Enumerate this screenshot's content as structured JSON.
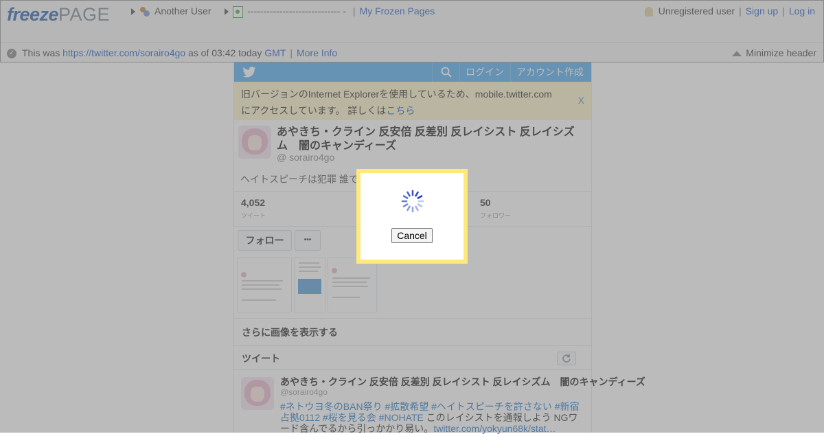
{
  "header": {
    "logo_freeze": "freeze",
    "logo_page": "PAGE",
    "breadcrumb_user": "Another User",
    "breadcrumb_page": "----------------------------- -",
    "breadcrumb_sep": "|",
    "my_frozen_pages": "My Frozen Pages",
    "unregistered_user": "Unregistered user",
    "sign_up": "Sign up",
    "log_in": "Log in",
    "info_prefix": "This was",
    "info_url": "https://twitter.com/sorairo4go",
    "info_time": "as of 03:42 today",
    "info_tz": "GMT",
    "more_info": "More Info",
    "minimize": "Minimize header",
    "accent_color": "#2a62c9"
  },
  "twitter": {
    "login": "ログイン",
    "signup": "アカウント作成",
    "notice_line1": "旧バージョンのInternet Explorerを使用しているため、mobile.twitter.com",
    "notice_line2": "にアクセスしています。 詳しくは",
    "notice_link": "こちら",
    "notice_close": "X",
    "name": "あやきち・クライン 反安倍 反差別 反レイシスト 反レイシズム　闇のキャンディーズ",
    "handle": "@ sorairo4go",
    "bio": "ヘイトスピーチは犯罪 誰で",
    "stats": [
      {
        "num": "4,052",
        "label": "ツイート"
      },
      {
        "num": "50",
        "label": "フォロワー"
      }
    ],
    "follow": "フォロー",
    "more": "•••",
    "more_media": "さらに画像を表示する",
    "tweets_header": "ツイート",
    "tweet": {
      "name": "あやきち・クライン 反安倍 反差別 反レイシスト 反レイシズム　闇のキャンディーズ",
      "handle": "@sorairo4go",
      "hashtags": "#ネトウヨ冬のBAN祭り #拡散希望 #ヘイトスピーチを許さない #新宿占拠0112 #桜を見る会 #NOHATE",
      "text": " このレイシストを通報しよう NGワード含んでるから引っかかり易い。",
      "link": "twitter.com/yokyun68k/stat…"
    },
    "brand_color": "#55acee"
  },
  "modal": {
    "cancel": "Cancel",
    "border_color": "#ffe97a"
  }
}
